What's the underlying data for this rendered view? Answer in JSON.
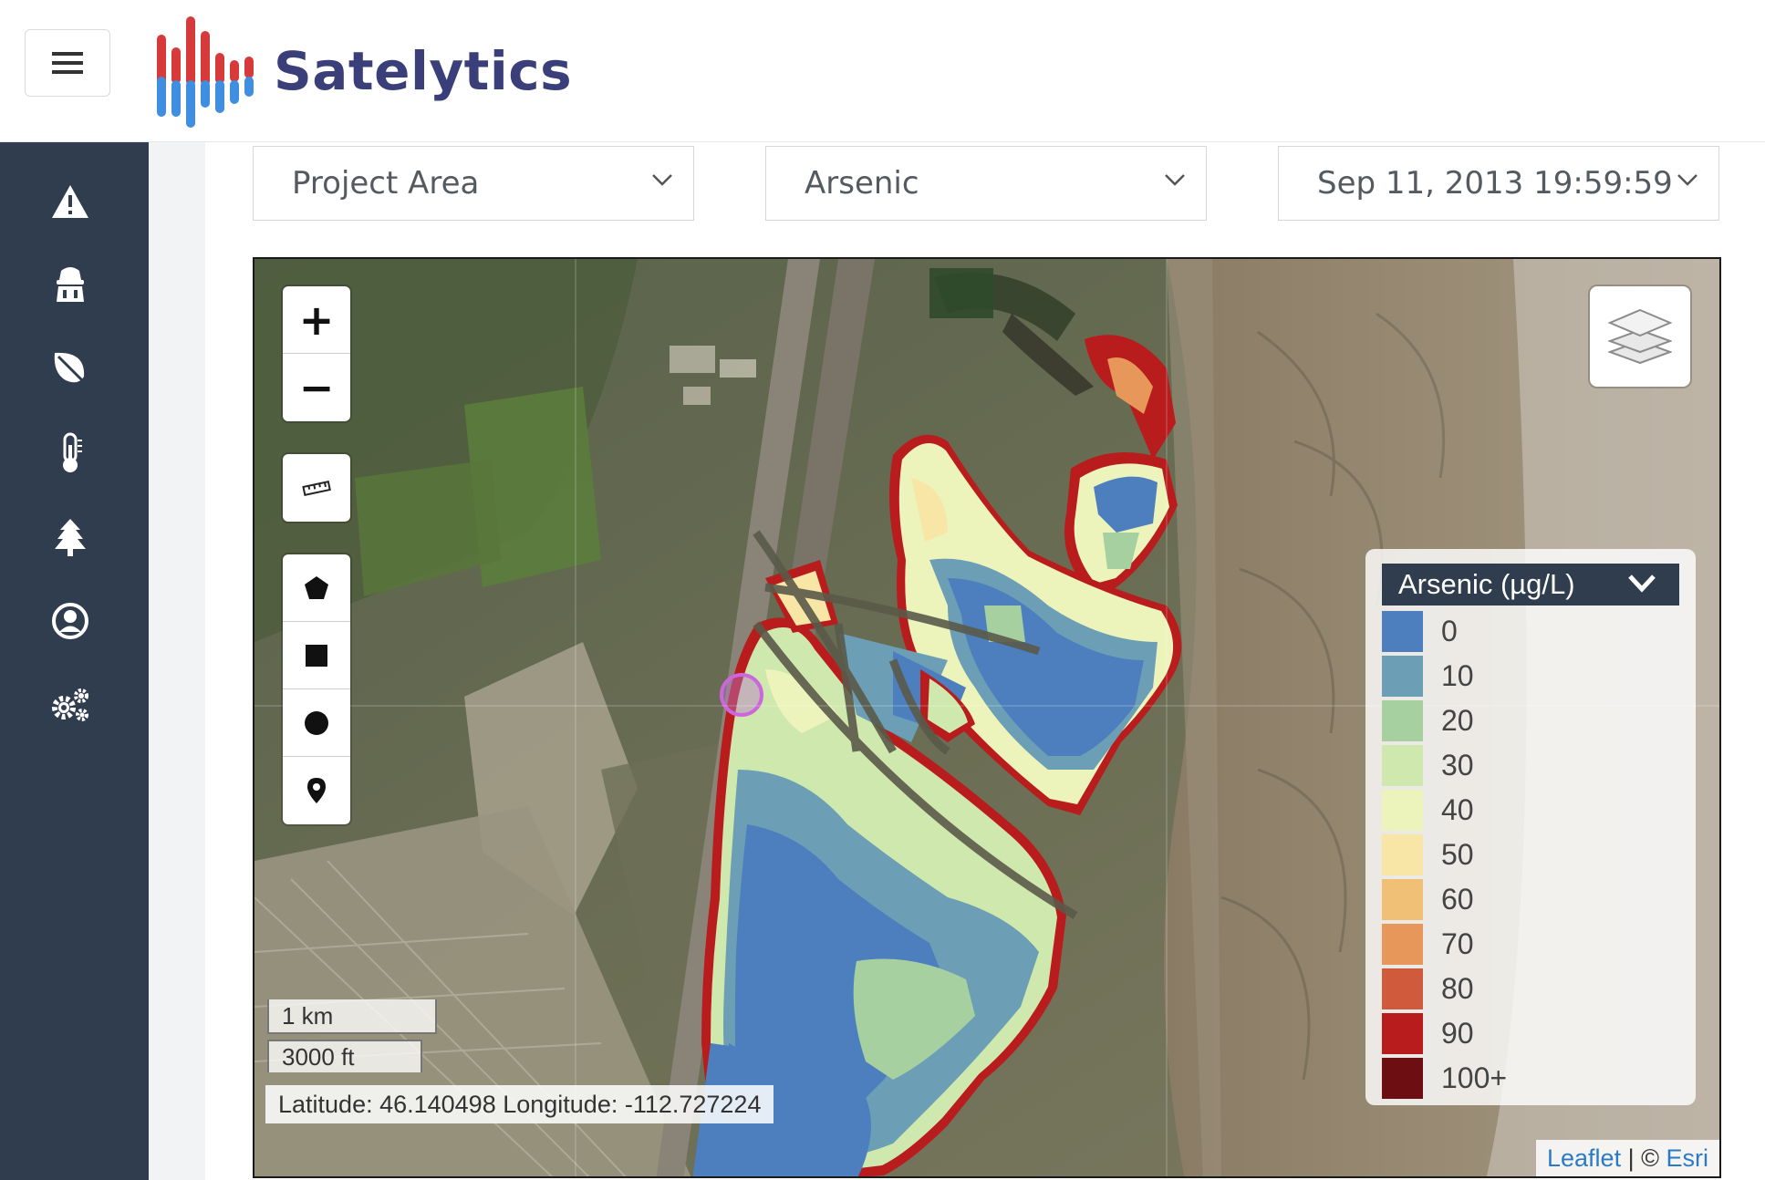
{
  "header": {
    "brand_name": "Satelytics",
    "menu_icon": "hamburger-icon"
  },
  "sidebar": {
    "items": [
      {
        "name": "alerts",
        "icon": "warning-icon"
      },
      {
        "name": "gas-emissions",
        "icon": "mask-icon"
      },
      {
        "name": "vegetation",
        "icon": "leaf-icon"
      },
      {
        "name": "temperature",
        "icon": "thermometer-icon"
      },
      {
        "name": "forestry",
        "icon": "tree-icon"
      },
      {
        "name": "account",
        "icon": "user-icon"
      },
      {
        "name": "settings",
        "icon": "gears-icon"
      }
    ]
  },
  "filters": {
    "area": "Project Area",
    "parameter": "Arsenic",
    "datetime": "Sep 11, 2013 19:59:59"
  },
  "map": {
    "zoom_in_label": "+",
    "zoom_out_label": "−",
    "tools": [
      "ruler-icon",
      "polygon-icon",
      "rectangle-icon",
      "circle-icon",
      "marker-icon"
    ],
    "legend": {
      "title": "Arsenic (µg/L)",
      "items": [
        {
          "label": "0",
          "color": "#4d7fbf"
        },
        {
          "label": "10",
          "color": "#6c9fb6"
        },
        {
          "label": "20",
          "color": "#a6d0a0"
        },
        {
          "label": "30",
          "color": "#cfe8ad"
        },
        {
          "label": "40",
          "color": "#edf4bb"
        },
        {
          "label": "50",
          "color": "#f7e6a5"
        },
        {
          "label": "60",
          "color": "#f0c077"
        },
        {
          "label": "70",
          "color": "#e8975a"
        },
        {
          "label": "80",
          "color": "#cf5a3c"
        },
        {
          "label": "90",
          "color": "#b81c1c"
        },
        {
          "label": "100+",
          "color": "#6d0e12"
        }
      ]
    },
    "scale": {
      "metric": "1 km",
      "imperial": "3000 ft"
    },
    "coordinates": "Latitude: 46.140498 Longitude: -112.727224",
    "attribution": {
      "leaflet": "Leaflet",
      "separator": " | © ",
      "provider": "Esri"
    }
  }
}
